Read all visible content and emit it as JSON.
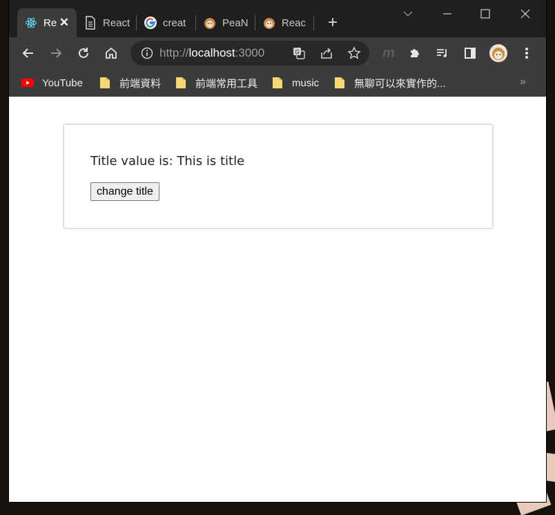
{
  "browser": {
    "tabs": [
      {
        "label": "Re",
        "favicon": "react-icon",
        "active": true
      },
      {
        "label": "React",
        "favicon": "document-icon",
        "active": false
      },
      {
        "label": "creat",
        "favicon": "google-icon",
        "active": false
      },
      {
        "label": "PeaN",
        "favicon": "hedgehog-icon",
        "active": false
      },
      {
        "label": "Reac",
        "favicon": "hedgehog-icon",
        "active": false
      }
    ],
    "close_glyph": "✕",
    "new_tab_glyph": "+",
    "address": {
      "scheme": "http://",
      "host": "localhost",
      "port": ":3000"
    },
    "ghost_glyph": "m",
    "bookmarks": [
      {
        "label": "YouTube",
        "icon": "youtube-icon"
      },
      {
        "label": "前端資料",
        "icon": "folder-icon"
      },
      {
        "label": "前端常用工具",
        "icon": "folder-icon"
      },
      {
        "label": "music",
        "icon": "folder-icon"
      },
      {
        "label": "無聊可以來實作的...",
        "icon": "folder-icon"
      }
    ],
    "bookmarks_more": "»"
  },
  "page": {
    "title_text": "Title value is: This is title",
    "change_button_label": "change title"
  },
  "colors": {
    "titlebar": "#1f1f1f",
    "toolbar": "#3c3c3c",
    "omnibox": "#282828",
    "folder": "#f6d776",
    "youtube": "#ff0000"
  }
}
